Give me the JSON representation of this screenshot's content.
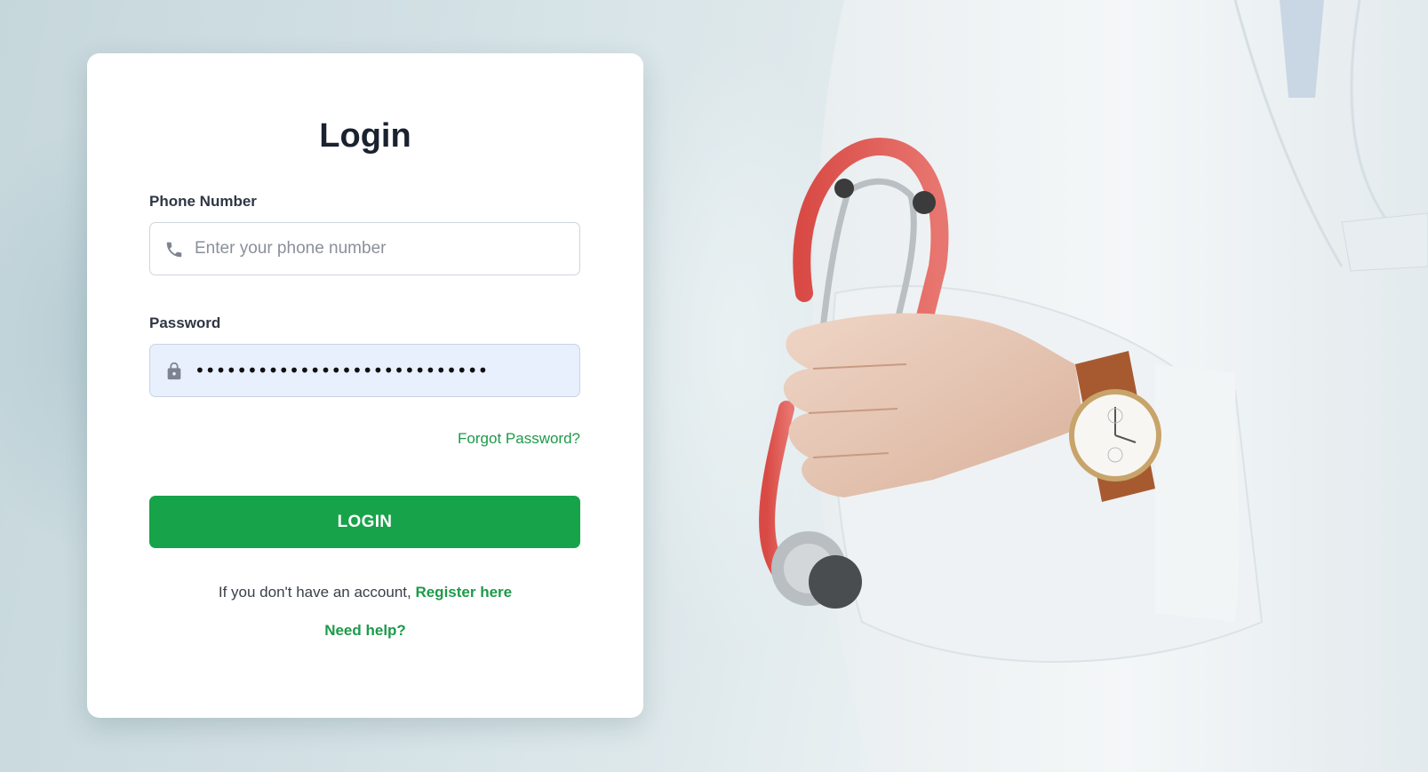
{
  "colors": {
    "accent": "#17a34a",
    "link": "#1d9a4b",
    "card": "#ffffff",
    "autofill_bg": "#e8f0fe"
  },
  "login": {
    "title": "Login",
    "phone": {
      "label": "Phone Number",
      "placeholder": "Enter your phone number",
      "value": "",
      "icon": "phone-icon"
    },
    "password": {
      "label": "Password",
      "masked_value": "••••••••••••••••••••••••••••",
      "icon": "lock-icon"
    },
    "forgot_label": "Forgot Password?",
    "submit_label": "LOGIN",
    "register_prompt": "If you don't have an account,",
    "register_link": "Register here",
    "help_link": "Need help?"
  },
  "hero": {
    "image": "doctor-with-stethoscope-and-watch"
  }
}
